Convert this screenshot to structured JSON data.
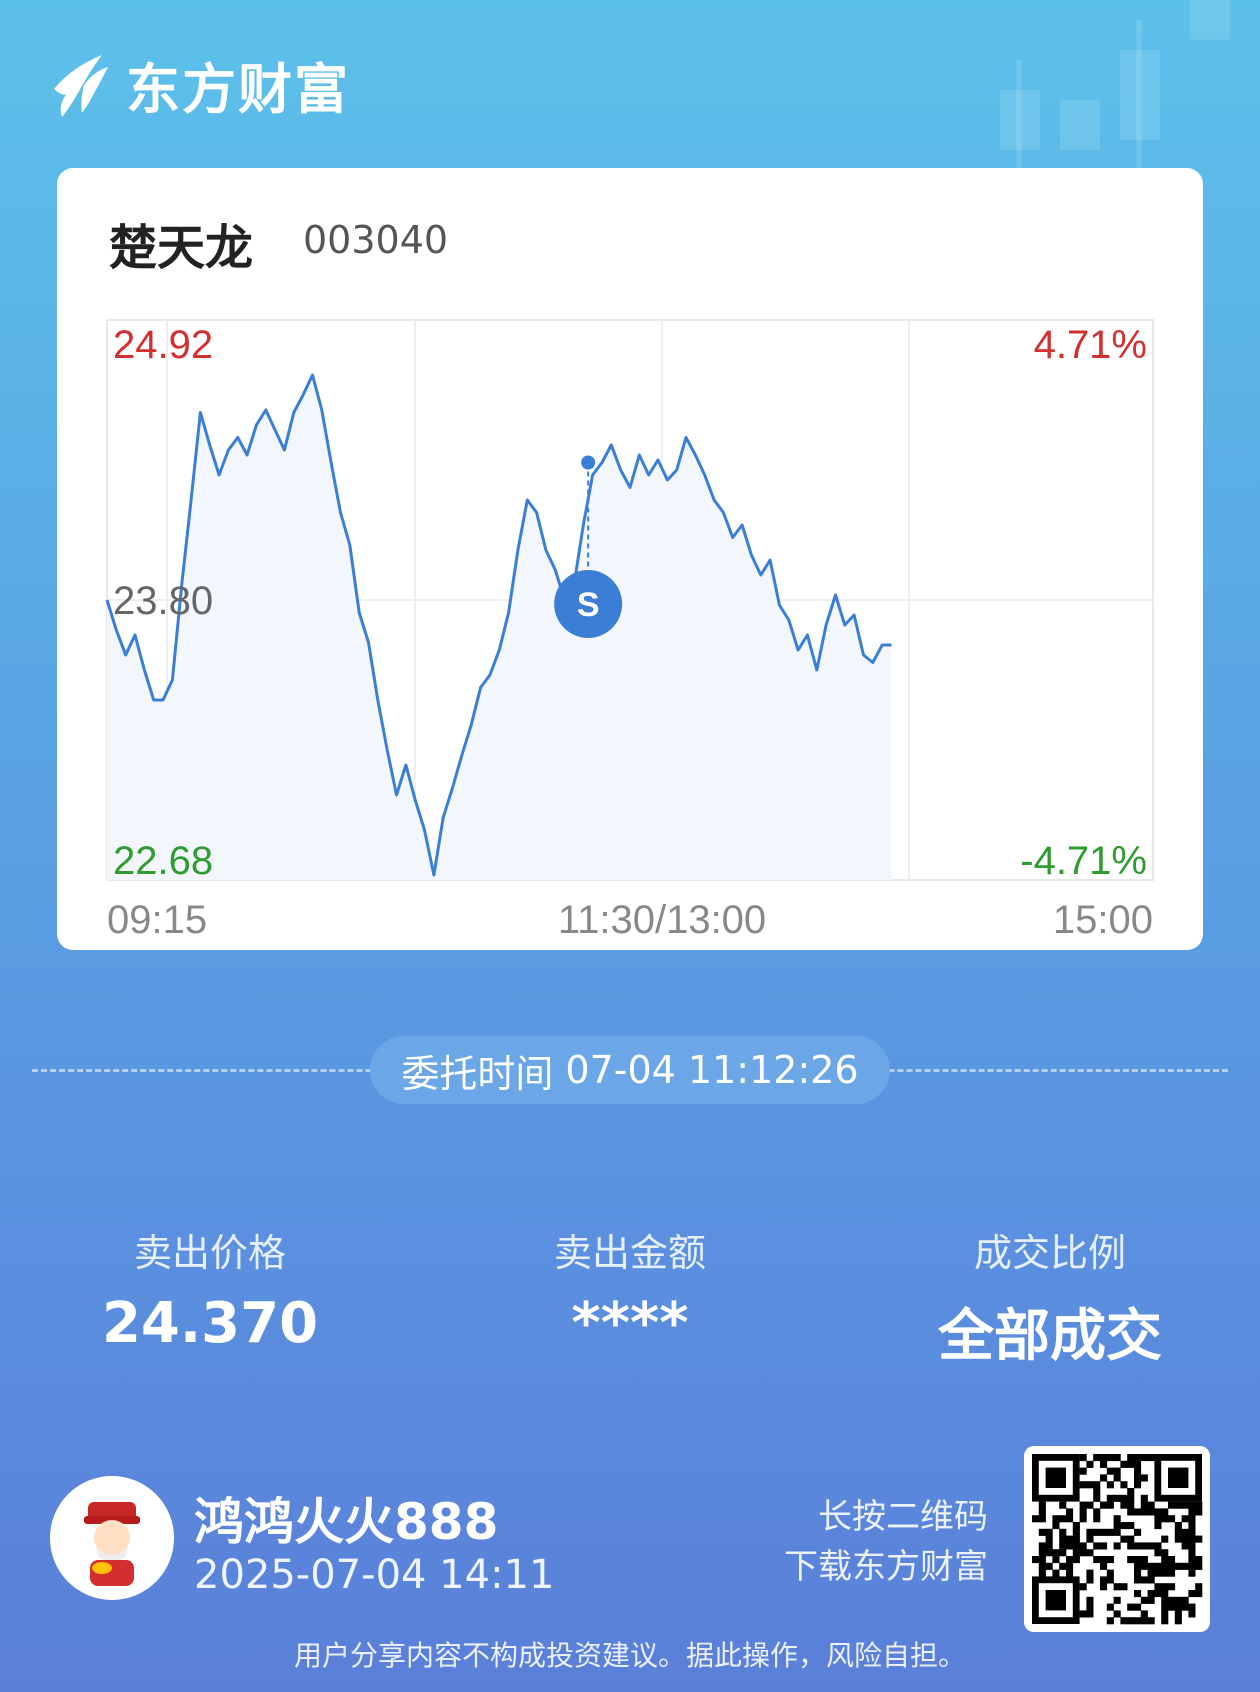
{
  "brand": {
    "name": "东方财富"
  },
  "stock": {
    "name": "楚天龙",
    "code": "003040"
  },
  "chart_data": {
    "type": "line",
    "y_top_label": "24.92",
    "y_mid_label": "23.80",
    "y_bottom_label": "22.68",
    "pct_top_label": "4.71%",
    "pct_bottom_label": "-4.71%",
    "x_labels": [
      "09:15",
      "11:30/13:00",
      "15:00"
    ],
    "ylim": [
      22.68,
      24.92
    ],
    "prev_close": 23.8,
    "marker": {
      "label": "S",
      "x": 0.46,
      "y": 24.35
    },
    "values": [
      23.8,
      23.68,
      23.58,
      23.66,
      23.52,
      23.4,
      23.4,
      23.48,
      23.86,
      24.2,
      24.55,
      24.42,
      24.3,
      24.4,
      24.45,
      24.38,
      24.5,
      24.56,
      24.48,
      24.4,
      24.55,
      24.62,
      24.7,
      24.56,
      24.35,
      24.15,
      24.02,
      23.75,
      23.63,
      23.4,
      23.2,
      23.02,
      23.14,
      23.0,
      22.88,
      22.7,
      22.93,
      23.05,
      23.18,
      23.3,
      23.45,
      23.5,
      23.6,
      23.75,
      24.0,
      24.2,
      24.15,
      24.0,
      23.92,
      23.8,
      23.86,
      24.1,
      24.3,
      24.35,
      24.42,
      24.32,
      24.25,
      24.38,
      24.3,
      24.36,
      24.28,
      24.32,
      24.45,
      24.38,
      24.3,
      24.2,
      24.15,
      24.05,
      24.1,
      23.98,
      23.9,
      23.96,
      23.78,
      23.72,
      23.6,
      23.66,
      23.52,
      23.7,
      23.82,
      23.7,
      23.74,
      23.58,
      23.55,
      23.62,
      23.62
    ]
  },
  "order": {
    "label": "委托时间",
    "time": "07-04 11:12:26"
  },
  "stats": [
    {
      "label": "卖出价格",
      "value": "24.370"
    },
    {
      "label": "卖出金额",
      "value": "****"
    },
    {
      "label": "成交比例",
      "value": "全部成交"
    }
  ],
  "user": {
    "name": "鸿鸿火火888",
    "time": "2025-07-04 14:11"
  },
  "qr_hint": {
    "line1": "长按二维码",
    "line2": "下载东方财富"
  },
  "disclaimer": "用户分享内容不构成投资建议。据此操作，风险自担。",
  "colors": {
    "up": "#d32f2f",
    "down": "#2e9c2e",
    "line": "#3a7fd5",
    "marker": "#3a7fd5"
  }
}
